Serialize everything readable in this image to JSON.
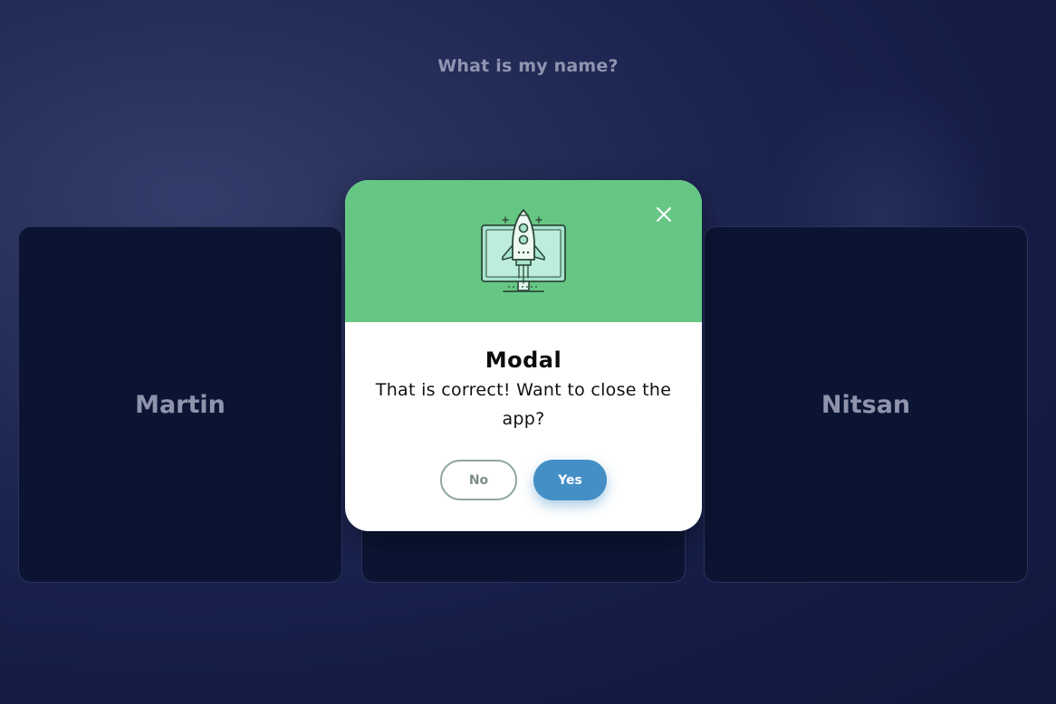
{
  "page": {
    "question": "What is my name?"
  },
  "cards": [
    {
      "label": "Martin"
    },
    {
      "label": ""
    },
    {
      "label": "Nitsan"
    }
  ],
  "modal": {
    "title": "Modal",
    "message": "That is correct! Want to close the app?",
    "no_label": "No",
    "yes_label": "Yes",
    "icons": {
      "header": "rocket-launch-monitor-icon",
      "close": "close-icon"
    }
  },
  "colors": {
    "background": "#141c45",
    "card": "#0b1533",
    "modal_header": "#66c784",
    "yes_button": "#438fc6",
    "no_border": "#8fa79a"
  }
}
